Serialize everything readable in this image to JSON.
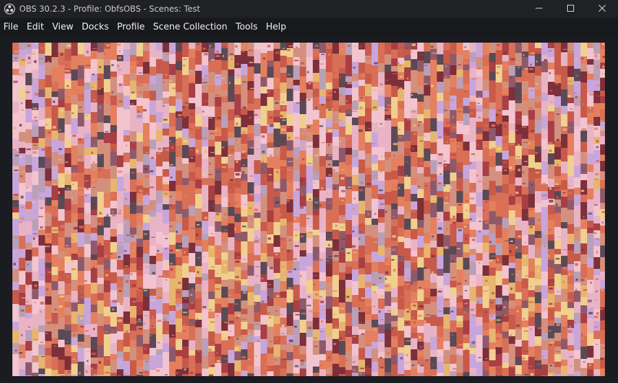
{
  "window": {
    "title": "OBS 30.2.3 - Profile: ObfsOBS - Scenes: Test",
    "app_icon": "obs-logo-icon",
    "controls": {
      "minimize_icon": "minimize-icon",
      "maximize_icon": "maximize-icon",
      "close_icon": "close-icon"
    }
  },
  "menubar": {
    "items": [
      {
        "label": "File"
      },
      {
        "label": "Edit"
      },
      {
        "label": "View"
      },
      {
        "label": "Docks"
      },
      {
        "label": "Profile"
      },
      {
        "label": "Scene Collection"
      },
      {
        "label": "Tools"
      },
      {
        "label": "Help"
      }
    ]
  },
  "preview": {
    "content": "pixel-glitch-mosaic",
    "palette": [
      "#c8a6dc",
      "#e9b3c6",
      "#f2c4cf",
      "#d96f56",
      "#e4805e",
      "#c85a4a",
      "#a83f45",
      "#7d2f3a",
      "#e7b56f",
      "#f0cf8f",
      "#5a4a55",
      "#b9a0b8",
      "#d4907e",
      "#8e5a6b"
    ]
  },
  "colors": {
    "titlebar_bg": "#202124",
    "menubar_bg": "#18191c",
    "app_bg": "#1b1c21",
    "text": "#f0f0f0"
  }
}
